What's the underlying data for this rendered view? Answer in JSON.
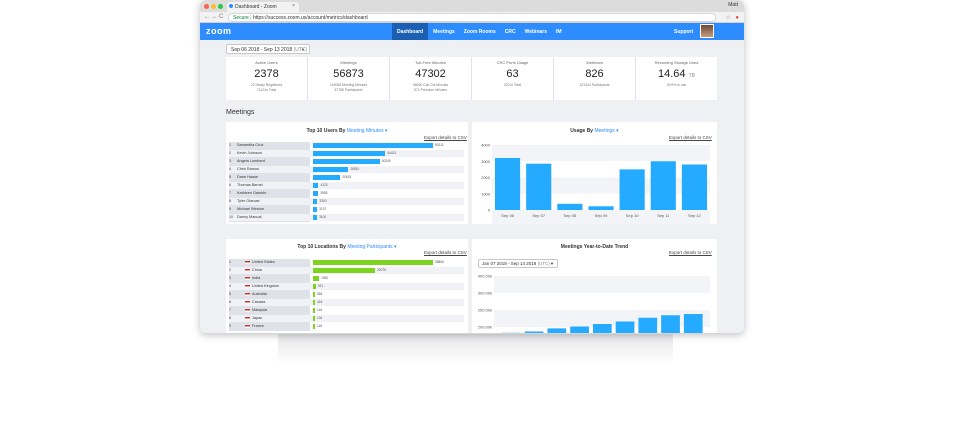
{
  "browser": {
    "tab_title": "Dashboard - Zoom",
    "tab_close": "×",
    "profile": "Matt",
    "url_secure": "Secure",
    "url": "https://success.zoom.us/account/metrics/dashboard",
    "nav_back": "←",
    "nav_forward": "→",
    "nav_reload": "C",
    "bookmark_icon": "☆",
    "extension_icon": "●",
    "dot_colors": [
      "#ff5f57",
      "#febc2e",
      "#28c840"
    ]
  },
  "header": {
    "logo": "zoom",
    "nav": [
      "Dashboard",
      "Meetings",
      "Zoom Rooms",
      "CRC",
      "Webinars",
      "IM"
    ],
    "support": "Support",
    "accent": "#2d8cff",
    "active_bg": "#1b5fb2"
  },
  "date_filter": {
    "range": "Sep 06 2018 - Sep 13 2018",
    "tz": "(UTC)",
    "caret": "▼"
  },
  "summary": [
    {
      "label": "Active Users",
      "value": "2378",
      "unit": "",
      "sub1": "22 Newly Registered",
      "sub2": "7143 in Total"
    },
    {
      "label": "Meetings",
      "value": "56873",
      "unit": "",
      "sub1": "160065 Meeting Minutes",
      "sub2": "67785 Participants"
    },
    {
      "label": "Toll-Free Minutes",
      "value": "47302",
      "unit": "",
      "sub1": "36690 Call Out Minutes",
      "sub2": "574 Premium Minutes"
    },
    {
      "label": "CRC Ports Usage",
      "value": "63",
      "unit": "",
      "sub1": "220 in Total",
      "sub2": ""
    },
    {
      "label": "Webinars",
      "value": "826",
      "unit": "",
      "sub1": "221344 Participants",
      "sub2": ""
    },
    {
      "label": "Recording Storage Used",
      "value": "14.64",
      "unit": "TB",
      "sub1": "30.9% in use",
      "sub2": ""
    }
  ],
  "section_title": "Meetings",
  "top_users": {
    "title_prefix": "Top 10 Users By",
    "title_link": "Meeting Minutes",
    "caret": "▾",
    "export": "Export details to CSV",
    "color": "#24aaff",
    "rows": [
      {
        "num": "1",
        "name": "Samantha Cruz",
        "value": 90211
      },
      {
        "num": "2",
        "name": "Kevin Johnson",
        "value": 54421
      },
      {
        "num": "3",
        "name": "Angela Lombard",
        "value": 50245
      },
      {
        "num": "4",
        "name": "Chris Ramos",
        "value": 26551
      },
      {
        "num": "5",
        "name": "Dane Haase",
        "value": 20515
      },
      {
        "num": "6",
        "name": "Thomas Barnel",
        "value": 4123
      },
      {
        "num": "7",
        "name": "Kathleen Gamble",
        "value": 3955
      },
      {
        "num": "8",
        "name": "Tyler Olarcae",
        "value": 3300
      },
      {
        "num": "9",
        "name": "Michael Weston",
        "value": 3137
      },
      {
        "num": "10",
        "name": "Danny Manual",
        "value": 3100
      }
    ]
  },
  "usage": {
    "title_prefix": "Usage By",
    "title_link": "Meetings",
    "caret": "▾",
    "export": "Export details to CSV",
    "color": "#24aaff"
  },
  "top_locations": {
    "title_prefix": "Top 10 Locations By",
    "title_link": "Meeting Participants",
    "caret": "▾",
    "export": "Export details to CSV",
    "color": "#7ed321",
    "rows": [
      {
        "num": "1",
        "name": "United States",
        "value": 38806
      },
      {
        "num": "2",
        "name": "China",
        "value": 20078
      },
      {
        "num": "3",
        "name": "India",
        "value": 1962
      },
      {
        "num": "4",
        "name": "United Kingdom",
        "value": 921
      },
      {
        "num": "5",
        "name": "Australia",
        "value": 584
      },
      {
        "num": "6",
        "name": "Canada",
        "value": 418
      },
      {
        "num": "7",
        "name": "Malaysia",
        "value": 144
      },
      {
        "num": "8",
        "name": "Japan",
        "value": 134
      },
      {
        "num": "9",
        "name": "France",
        "value": 116
      }
    ]
  },
  "ytd": {
    "title": "Meetings Year-to-Date Trend",
    "export": "Export details to CSV",
    "range": "Jan 07 2018 - Sep 14 2018",
    "tz": "(UTC)",
    "caret": "▼",
    "color": "#24aaff"
  },
  "chart_data": [
    {
      "type": "bar",
      "title": "Top 10 Users By Meeting Minutes",
      "orientation": "horizontal",
      "categories": [
        "Samantha Cruz",
        "Kevin Johnson",
        "Angela Lombard",
        "Chris Ramos",
        "Dane Haase",
        "Thomas Barnel",
        "Kathleen Gamble",
        "Tyler Olarcae",
        "Michael Weston",
        "Danny Manual"
      ],
      "values": [
        90211,
        54421,
        50245,
        26551,
        20515,
        4123,
        3955,
        3300,
        3137,
        3100
      ]
    },
    {
      "type": "bar",
      "title": "Usage By Meetings",
      "categories": [
        "Sep 06",
        "Sep 07",
        "Sep 08",
        "Sep 09",
        "Sep 10",
        "Sep 11",
        "Sep 12"
      ],
      "values": [
        3200,
        2850,
        380,
        230,
        2500,
        3000,
        2800
      ],
      "ylim": [
        0,
        4000
      ],
      "yticks": [
        "4000",
        "3000",
        "2000",
        "1000",
        "0"
      ]
    },
    {
      "type": "bar",
      "title": "Top 10 Locations By Meeting Participants",
      "orientation": "horizontal",
      "categories": [
        "United States",
        "China",
        "India",
        "United Kingdom",
        "Australia",
        "Canada",
        "Malaysia",
        "Japan",
        "France"
      ],
      "values": [
        38806,
        20078,
        1962,
        921,
        584,
        418,
        144,
        134,
        116
      ]
    },
    {
      "type": "bar",
      "title": "Meetings Year-to-Date Trend",
      "values": [
        10000,
        20000,
        45000,
        60000,
        80000,
        100000,
        130000,
        150000,
        160000
      ],
      "ylim": [
        0,
        400000
      ],
      "yticks": [
        "400.00k",
        "300.00k",
        "250.00k",
        "200.00k"
      ]
    }
  ]
}
